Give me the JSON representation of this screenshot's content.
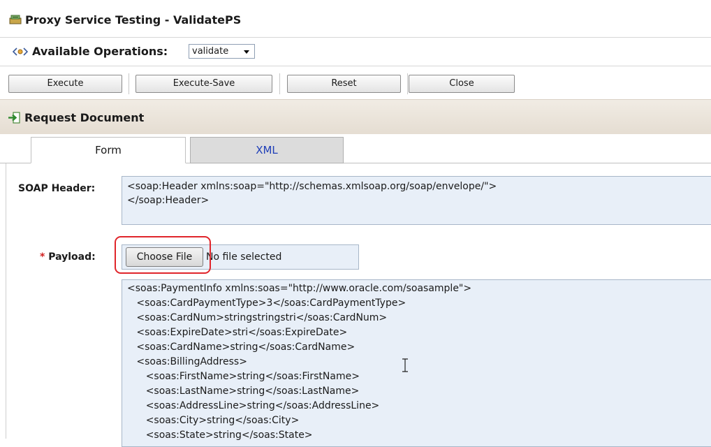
{
  "header": {
    "title": "Proxy Service Testing - ValidatePS",
    "icon": "proxy-service-icon"
  },
  "operations": {
    "label": "Available Operations:",
    "selected": "validate",
    "icon": "operations-icon"
  },
  "toolbar": {
    "execute": "Execute",
    "execute_save": "Execute-Save",
    "reset": "Reset",
    "close": "Close"
  },
  "section": {
    "title": "Request Document",
    "icon": "arrow-in-icon"
  },
  "tabs": {
    "form": "Form",
    "xml": "XML"
  },
  "soap_header": {
    "label": "SOAP Header:",
    "lines": [
      "<soap:Header xmlns:soap=\"http://schemas.xmlsoap.org/soap/envelope/\">",
      "</soap:Header>"
    ]
  },
  "payload": {
    "required_mark": "*",
    "label": "Payload:",
    "choose_file": "Choose File",
    "no_file": "No file selected",
    "lines": [
      "<soas:PaymentInfo xmlns:soas=\"http://www.oracle.com/soasample\">",
      "   <soas:CardPaymentType>3</soas:CardPaymentType>",
      "   <soas:CardNum>stringstringstri</soas:CardNum>",
      "   <soas:ExpireDate>stri</soas:ExpireDate>",
      "   <soas:CardName>string</soas:CardName>",
      "   <soas:BillingAddress>",
      "      <soas:FirstName>string</soas:FirstName>",
      "      <soas:LastName>string</soas:LastName>",
      "      <soas:AddressLine>string</soas:AddressLine>",
      "      <soas:City>string</soas:City>",
      "      <soas:State>string</soas:State>"
    ]
  },
  "colors": {
    "highlight": "#e0252b",
    "field_bg": "#e8eff8",
    "tab_link": "#1f3fb8",
    "required": "#d01f1f"
  }
}
